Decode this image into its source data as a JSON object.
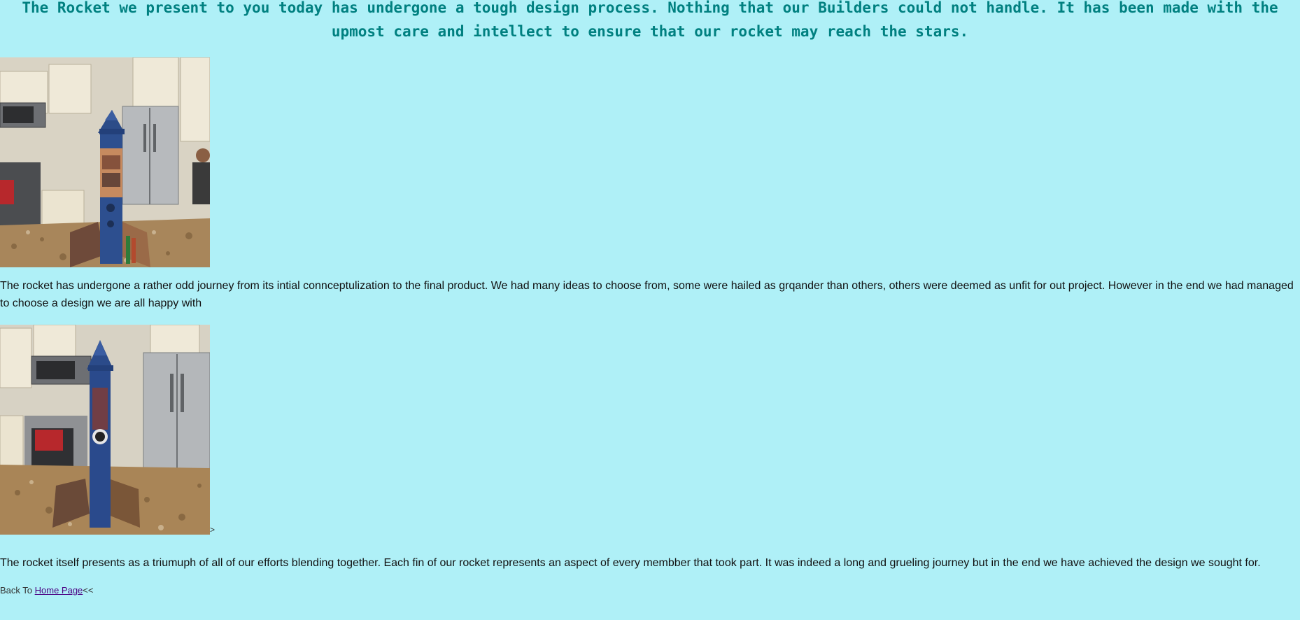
{
  "page": {
    "background_color": "#aff0f7",
    "heading_color": "#008080",
    "heading": "The Rocket we present to you today has undergone a tough design process. Nothing that our Builders could not handle. It has been made with the upmost care and intellect to ensure that our rocket may reach the stars."
  },
  "photos": [
    {
      "name": "rocket-photo-1",
      "description_icon": "rocket-kitchen-photo"
    },
    {
      "name": "rocket-photo-2",
      "description_icon": "rocket-kitchen-photo"
    }
  ],
  "paragraphs": {
    "first": "The rocket has undergone a rather odd journey from its intial connceptulization to the final product. We had many ideas to choose from, some were hailed as grqander than others, others were deemed as unfit for out project. However in the end we had managed to choose a design we are all happy with",
    "second": "The rocket itself presents as a triumuph of all of our efforts blending together. Each fin of our rocket represents an aspect of every membber that took part. It was indeed a long and grueling journey but in the end we have achieved the design we sought for."
  },
  "stray_markup": ">",
  "footer": {
    "prefix": "Back To ",
    "link_label": "Home Page",
    "suffix": "<<",
    "link_color": "#4b0082"
  }
}
